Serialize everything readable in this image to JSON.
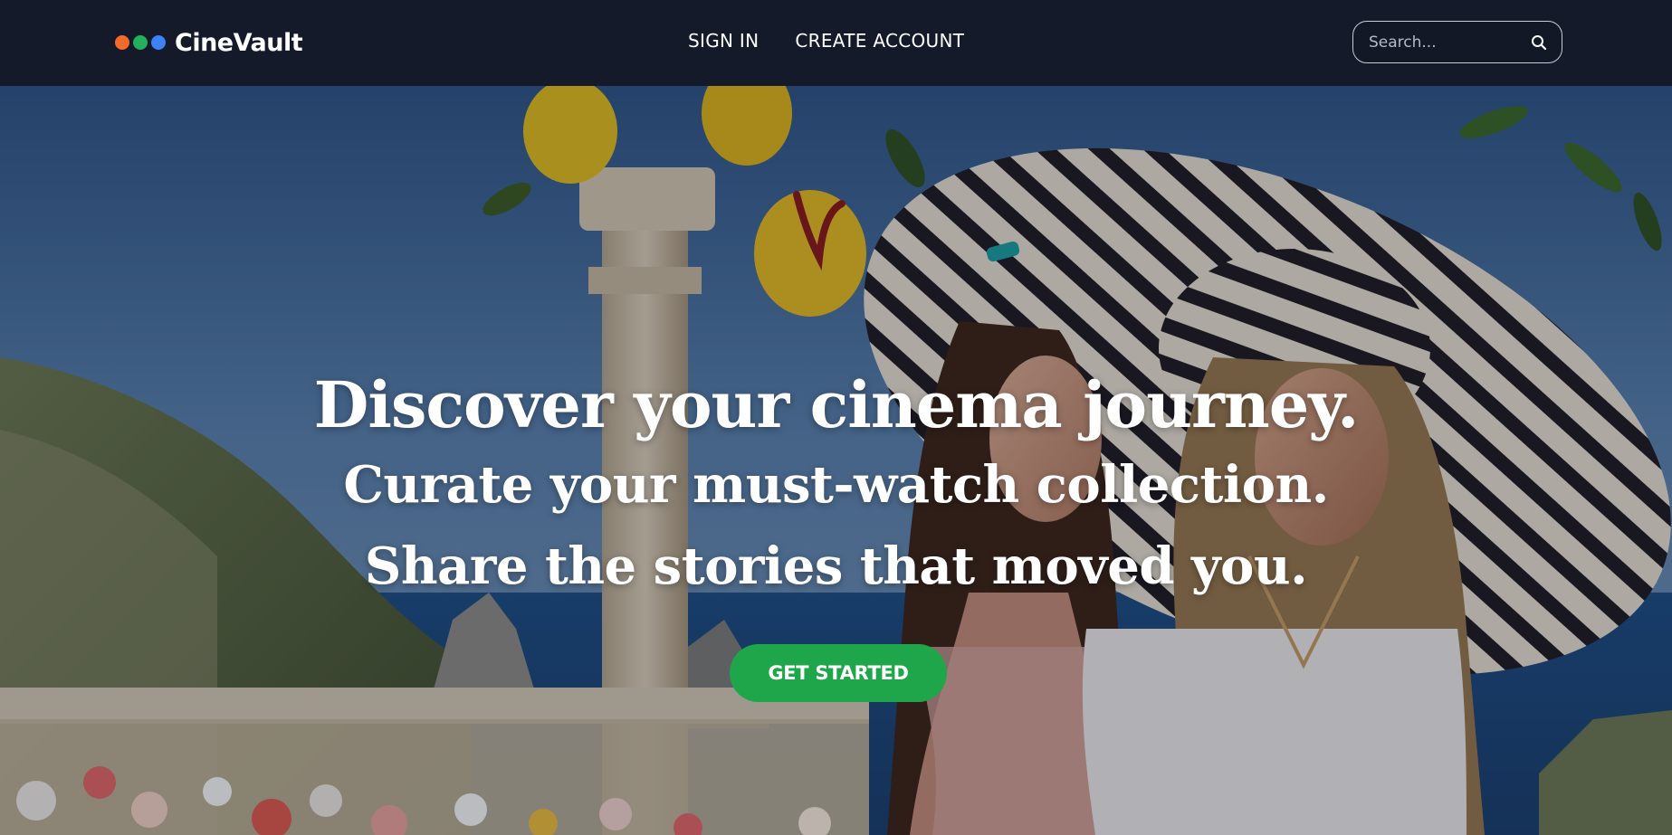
{
  "header": {
    "brand": {
      "name": "CineVault",
      "dot_colors": [
        "#f26b2a",
        "#22b05a",
        "#3b82f6"
      ]
    },
    "nav": [
      {
        "label": "SIGN IN"
      },
      {
        "label": "CREATE ACCOUNT"
      }
    ],
    "search": {
      "placeholder": "Search...",
      "value": "",
      "icon": "search-icon"
    }
  },
  "hero": {
    "title": "Discover your cinema journey.",
    "subtitle_lines": [
      "Curate your must-watch collection.",
      "Share the stories that moved you."
    ],
    "cta_label": "GET STARTED",
    "cta_color": "#1fa64a"
  }
}
